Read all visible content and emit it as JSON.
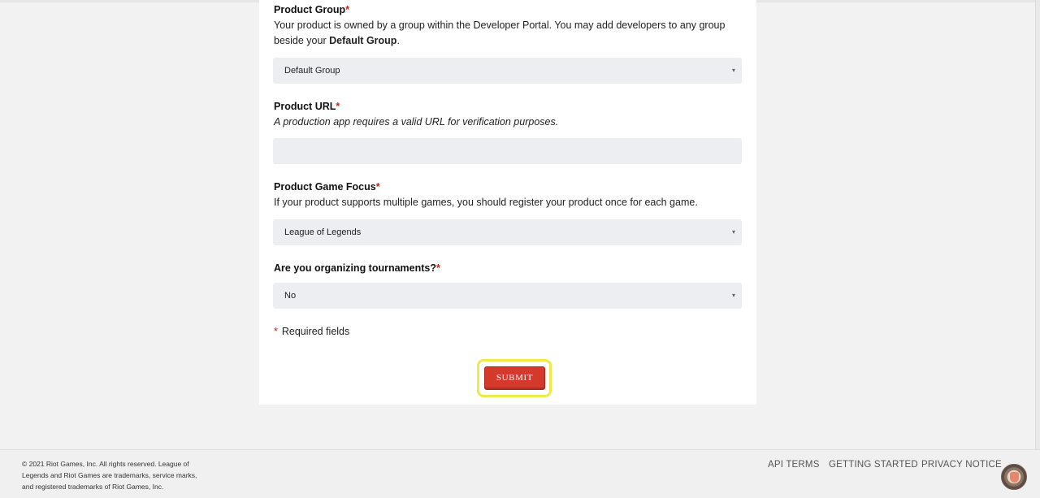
{
  "form": {
    "product_group": {
      "label": "Product Group",
      "required_mark": "*",
      "help_part1": "Your product is owned by a group within the Developer Portal. You may add developers to any group beside your ",
      "help_bold": "Default Group",
      "help_part2": ".",
      "selected": "Default Group"
    },
    "product_url": {
      "label": "Product URL",
      "required_mark": "*",
      "help": "A production app requires a valid URL for verification purposes.",
      "value": ""
    },
    "product_game_focus": {
      "label": "Product Game Focus",
      "required_mark": "*",
      "help": "If your product supports multiple games, you should register your product once for each game.",
      "selected": "League of Legends"
    },
    "tournaments": {
      "label": "Are you organizing tournaments?",
      "required_mark": "*",
      "selected": "No"
    },
    "required_note": {
      "star": "*",
      "text": "Required fields"
    },
    "submit_label": "SUBMIT"
  },
  "footer": {
    "copyright": "© 2021 Riot Games, Inc. All rights reserved. League of Legends and Riot Games are trademarks, service marks, and registered trademarks of Riot Games, Inc.",
    "links": [
      "API TERMS",
      "GETTING STARTED",
      "PRIVACY NOTICE"
    ]
  },
  "icons": {
    "select_caret": "▾",
    "avatar": "user-avatar-icon"
  },
  "colors": {
    "required": "#c0271d",
    "submit_bg": "#d33a2c",
    "highlight": "#f1e84a",
    "field_bg": "#eceef1"
  }
}
